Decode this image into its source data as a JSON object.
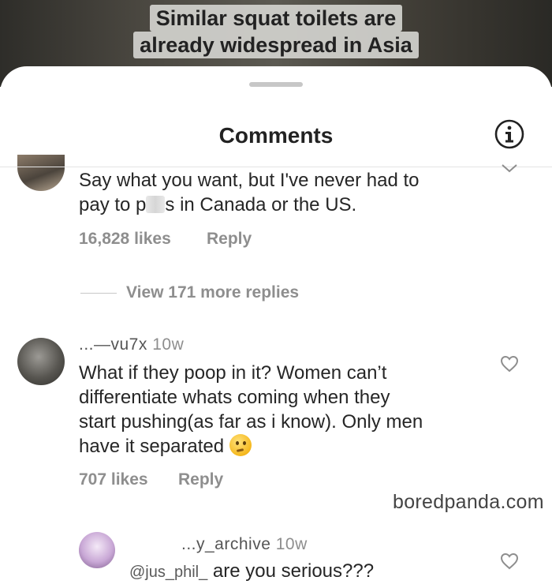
{
  "video": {
    "caption_line1": "Similar squat toilets are",
    "caption_line2": "already widespread in Asia"
  },
  "sheet": {
    "title": "Comments",
    "info_icon": "info-icon"
  },
  "comments": [
    {
      "text_before": "Say what you want, but I've never had to",
      "text_line2_a": "pay to p",
      "text_line2_b": "s in Canada or the US.",
      "likes": "16,828 likes",
      "reply_label": "Reply",
      "view_replies": "View 171 more replies"
    },
    {
      "username": "...—vu7x",
      "time": "10w",
      "lines": [
        "What if they poop in it? Women can’t",
        "differentiate whats coming when they",
        "start pushing(as far as i know). Only men",
        "have it separated"
      ],
      "emoji": "thinking-face",
      "likes": "707 likes",
      "reply_label": "Reply"
    },
    {
      "username": "...y_archive",
      "time": "10w",
      "mention": "@jus_phil_",
      "text": "are you serious???"
    }
  ],
  "watermark": "boredpanda.com"
}
